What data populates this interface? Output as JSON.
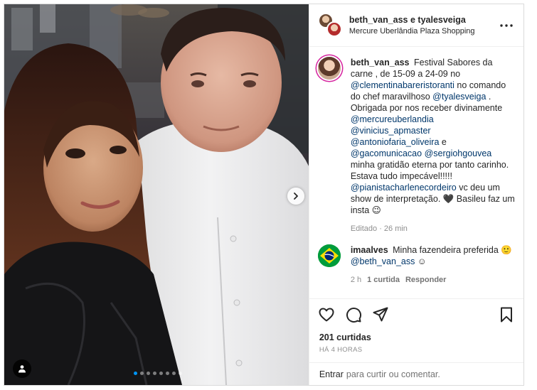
{
  "post": {
    "header": {
      "authors": "beth_van_ass e tyalesveiga",
      "location": "Mercure Uberlândia Plaza Shopping"
    },
    "carousel": {
      "slide_count": 8,
      "active_index": 0
    },
    "caption": {
      "user": "beth_van_ass",
      "parts": [
        {
          "t": "text",
          "v": "Festival Sabores da carne , de 15-09 a 24-09 no "
        },
        {
          "t": "mention",
          "v": "@clementinabareristoranti"
        },
        {
          "t": "text",
          "v": " no comando do chef maravilhoso "
        },
        {
          "t": "mention",
          "v": "@tyalesveiga"
        },
        {
          "t": "text",
          "v": " . Obrigada por nos receber divinamente "
        },
        {
          "t": "mention",
          "v": "@mercureuberlandia"
        },
        {
          "t": "text",
          "v": " "
        },
        {
          "t": "mention",
          "v": "@vinicius_apmaster"
        },
        {
          "t": "text",
          "v": " "
        },
        {
          "t": "mention",
          "v": "@antoniofaria_oliveira"
        },
        {
          "t": "text",
          "v": " e "
        },
        {
          "t": "mention",
          "v": "@gacomunicacao"
        },
        {
          "t": "text",
          "v": " "
        },
        {
          "t": "mention",
          "v": "@sergiohgouvea"
        },
        {
          "t": "text",
          "v": " minha gratidão eterna por tanto carinho. Estava tudo impecável!!!!! "
        },
        {
          "t": "mention",
          "v": "@pianistacharlenecordeiro"
        },
        {
          "t": "text",
          "v": " vc deu um show de interpretação. 🖤 Basileu faz um insta 😉"
        }
      ],
      "meta": "Editado · 26 min"
    },
    "comments": [
      {
        "user": "imaalves",
        "text": "Minha fazendeira preferida 🙂",
        "mention": "@beth_van_ass",
        "mention_suffix": " ☺",
        "age": "2 h",
        "likes": "1 curtida",
        "reply": "Responder"
      }
    ],
    "likes": "201 curtidas",
    "posted": "HÁ 4 HORAS",
    "add_comment": {
      "cta": "Entrar",
      "placeholder": "para curtir ou comentar."
    }
  },
  "icons": {
    "more": "more-horizontal-icon",
    "like": "heart-icon",
    "comment": "comment-icon",
    "share": "share-icon",
    "save": "bookmark-icon",
    "next": "chevron-right-icon",
    "tag": "user-tag-icon"
  },
  "colors": {
    "link": "#00376b",
    "active_dot": "#0095f6",
    "story_ring": "#d6249f",
    "muted": "#8e8e8e"
  }
}
